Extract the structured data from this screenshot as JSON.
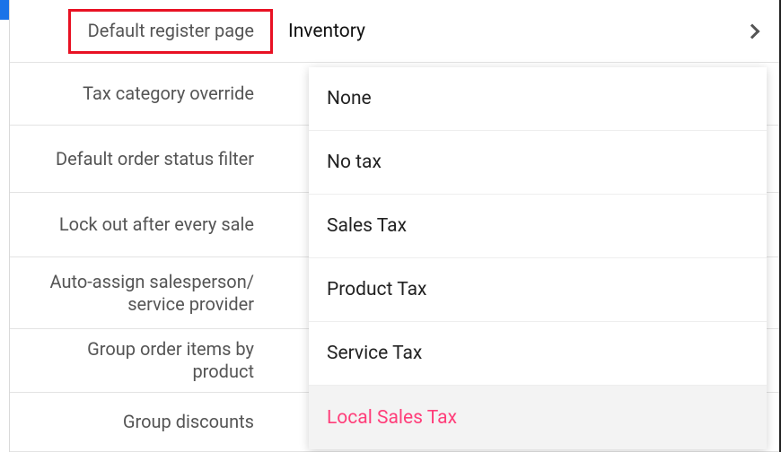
{
  "settings": {
    "default_register_page": {
      "label": "Default register page",
      "value": "Inventory"
    },
    "tax_category_override": {
      "label": "Tax category override"
    },
    "default_order_status_filter": {
      "label": "Default order status filter"
    },
    "lock_out_after_every_sale": {
      "label": "Lock out after every sale"
    },
    "auto_assign_salesperson": {
      "label_line1": "Auto-assign salesperson/",
      "label_line2": "service provider"
    },
    "group_order_items_by_product": {
      "label": "Group order items by product"
    },
    "group_discounts": {
      "label": "Group discounts"
    }
  },
  "dropdown": {
    "options": [
      {
        "label": "None"
      },
      {
        "label": "No tax"
      },
      {
        "label": "Sales Tax"
      },
      {
        "label": "Product Tax"
      },
      {
        "label": "Service Tax"
      },
      {
        "label": "Local Sales Tax",
        "selected": true
      }
    ]
  },
  "colors": {
    "accent": "#1a73e8",
    "highlight_box": "#e81123",
    "selected_text": "#ff3e7a"
  }
}
